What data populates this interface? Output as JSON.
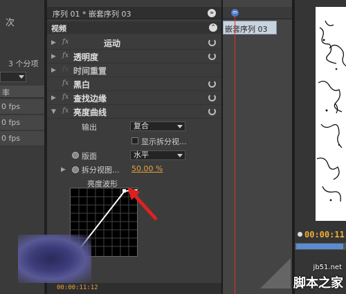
{
  "left_panel": {
    "top_text": "次",
    "item_count": "3 个分项",
    "column_header": "率",
    "rows": [
      "0 fps",
      "0 fps",
      "0 fps"
    ]
  },
  "effect_controls": {
    "tab_title": "序列 01 * 嵌套序列 03",
    "section_label": "视频",
    "effects": [
      {
        "label": "运动",
        "expanded": false,
        "fx": true
      },
      {
        "label": "透明度",
        "expanded": false,
        "fx": true
      },
      {
        "label": "时间重置",
        "expanded": false,
        "fx": false
      },
      {
        "label": "黑白",
        "expanded": false,
        "fx": true
      },
      {
        "label": "查找边缘",
        "expanded": false,
        "fx": true
      },
      {
        "label": "亮度曲线",
        "expanded": true,
        "fx": true
      }
    ],
    "props": {
      "output_label": "输出",
      "output_value": "复合",
      "split_checkbox_label": "显示拆分视...",
      "layout_label": "版面",
      "layout_value": "水平",
      "split_pct_label": "拆分视图...",
      "split_pct_value": "50.00 %",
      "waveform_label": "亮度波形"
    },
    "bottom_timecode": "00:00:11:12"
  },
  "timeline": {
    "clip_label": "嵌套序列 03",
    "playhead_label": "m"
  },
  "program_monitor": {
    "timecode": "00:00:11"
  },
  "watermark": {
    "line1": "jb51.net",
    "line2": "脚本之家"
  },
  "colors": {
    "accent_value": "#e8a33d",
    "playhead": "#e03030",
    "clip": "#c9d3df"
  }
}
